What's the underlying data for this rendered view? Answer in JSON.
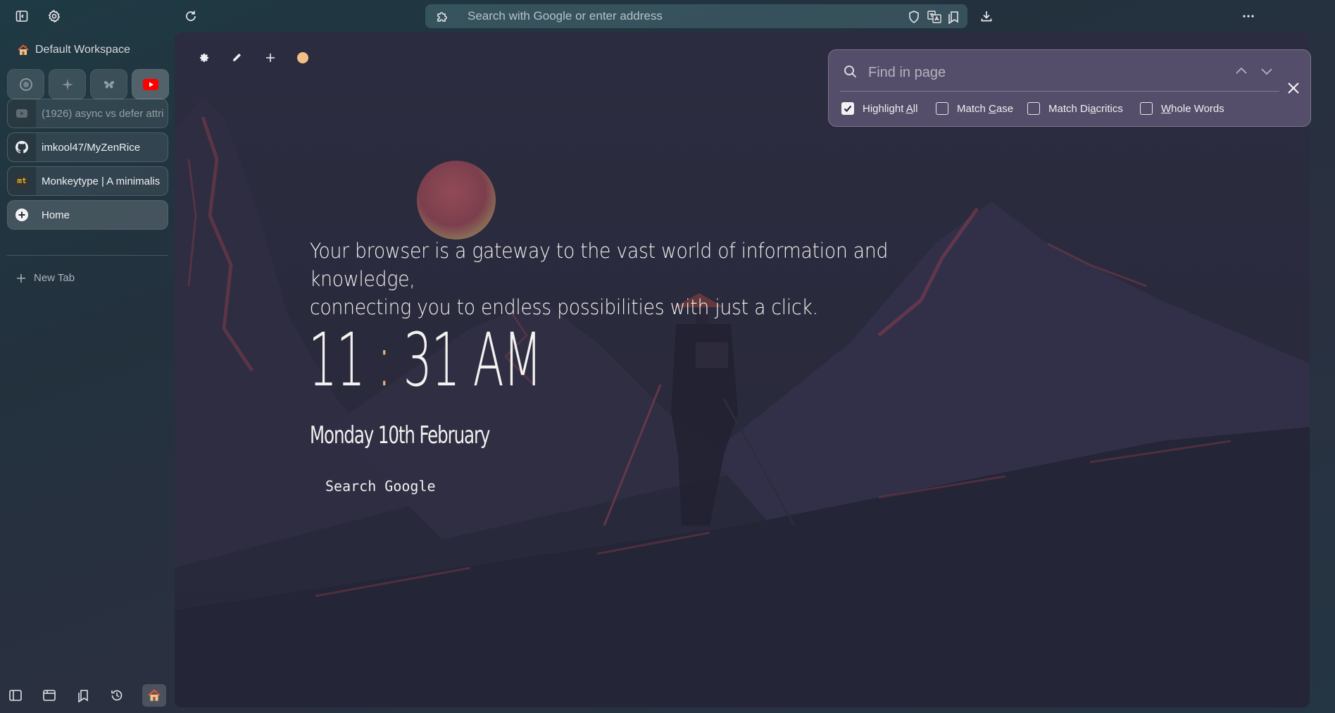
{
  "topbar": {
    "url_placeholder": "Search with Google or enter address"
  },
  "sidebar": {
    "workspace_title": "Default Workspace",
    "pinned": [
      {
        "name": "pinned-site-1",
        "icon": "circle-logo-icon"
      },
      {
        "name": "pinned-site-2",
        "icon": "sparkle-icon"
      },
      {
        "name": "pinned-site-3",
        "icon": "butterfly-icon"
      },
      {
        "name": "pinned-youtube",
        "icon": "youtube-icon",
        "color": "#ff0000"
      }
    ],
    "tabs": [
      {
        "label": "(1926) async vs defer attri",
        "icon": "youtube-dim-icon"
      },
      {
        "label": "imkool47/MyZenRice",
        "icon": "github-icon"
      },
      {
        "label": "Monkeytype | A minimalis",
        "icon": "monkeytype-icon",
        "icon_text": "mt"
      },
      {
        "label": "Home",
        "icon": "plus-circle-icon"
      }
    ],
    "new_tab_label": "New Tab"
  },
  "content": {
    "quote_line1": "Your browser is a gateway to the vast world of information and knowledge,",
    "quote_line2": "connecting you to endless possibilities with just a click.",
    "clock_hours": "11",
    "clock_colon": ":",
    "clock_minutes": "31 AM",
    "date": "Monday 10th February",
    "search_placeholder": "Search Google"
  },
  "findbar": {
    "placeholder": "Find in page",
    "options": [
      {
        "pre": "Highlight ",
        "key": "A",
        "post": "ll",
        "checked": true
      },
      {
        "pre": "Match ",
        "key": "C",
        "post": "ase",
        "checked": false
      },
      {
        "pre": "Match Di",
        "key": "a",
        "post": "critics",
        "checked": false
      },
      {
        "pre": "",
        "key": "W",
        "post": "hole Words",
        "checked": false
      }
    ]
  },
  "colors": {
    "accent_dot": "#f2bf86",
    "clock_colon": "#e7b078",
    "background": "#2a2b3d"
  }
}
